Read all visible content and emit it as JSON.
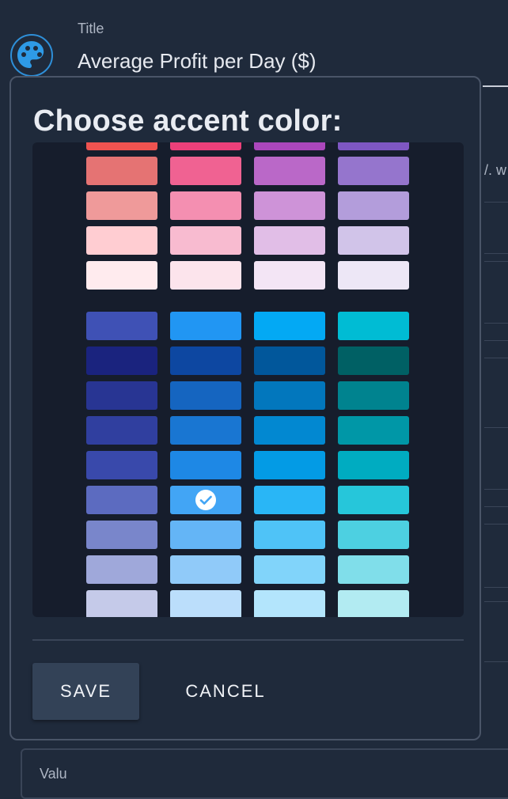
{
  "background": {
    "field_label": "Title",
    "field_value": "Average Profit per Day ($)",
    "side_text": "/. w",
    "bottom_text": "Valu"
  },
  "dialog": {
    "title": "Choose accent color:",
    "save_label": "SAVE",
    "cancel_label": "CANCEL",
    "selected": {
      "row": 10,
      "col": 1
    },
    "swatch_rows": [
      [
        "#ef5350",
        "#ec407a",
        "#ab47bc",
        "#7e57c2"
      ],
      [
        "#e57373",
        "#f06292",
        "#ba68c8",
        "#9575cd"
      ],
      [
        "#ef9a9a",
        "#f48fb1",
        "#ce93d8",
        "#b39ddb"
      ],
      [
        "#ffcdd2",
        "#f8bbd0",
        "#e1bee7",
        "#d1c4e9"
      ],
      [
        "#ffebee",
        "#fce4ec",
        "#f3e5f5",
        "#ede7f6"
      ],
      [
        "#3f51b5",
        "#2196f3",
        "#03a9f4",
        "#00bcd4"
      ],
      [
        "#1a237e",
        "#0d47a1",
        "#01579b",
        "#006064"
      ],
      [
        "#283593",
        "#1565c0",
        "#0277bd",
        "#00838f"
      ],
      [
        "#303f9f",
        "#1976d2",
        "#0288d1",
        "#0097a7"
      ],
      [
        "#3949ab",
        "#1e88e5",
        "#039be5",
        "#00acc1"
      ],
      [
        "#5c6bc0",
        "#42a5f5",
        "#29b6f6",
        "#26c6da"
      ],
      [
        "#7986cb",
        "#64b5f6",
        "#4fc3f7",
        "#4dd0e1"
      ],
      [
        "#9fa8da",
        "#90caf9",
        "#81d4fa",
        "#80deea"
      ],
      [
        "#c5cae9",
        "#bbdefb",
        "#b3e5fc",
        "#b2ebf2"
      ]
    ]
  }
}
